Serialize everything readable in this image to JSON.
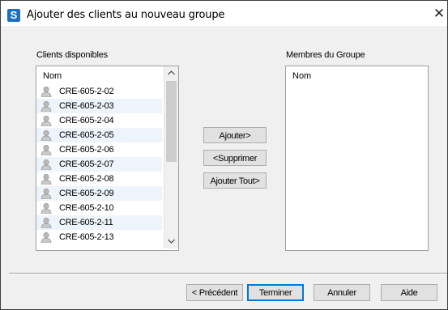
{
  "window": {
    "title": "Ajouter des clients au nouveau groupe",
    "close_glyph": "✕",
    "app_glyph": "S"
  },
  "available": {
    "label": "Clients disponibles",
    "header": "Nom",
    "items": [
      "CRE-605-2-02",
      "CRE-605-2-03",
      "CRE-605-2-04",
      "CRE-605-2-05",
      "CRE-605-2-06",
      "CRE-605-2-07",
      "CRE-605-2-08",
      "CRE-605-2-09",
      "CRE-605-2-10",
      "CRE-605-2-11",
      "CRE-605-2-13"
    ]
  },
  "members": {
    "label": "Membres du Groupe",
    "header": "Nom"
  },
  "actions": {
    "add": "Ajouter>",
    "remove": "<Supprimer",
    "add_all": "Ajouter Tout>"
  },
  "footer": {
    "previous": "< Précédent",
    "finish": "Terminer",
    "cancel": "Annuler",
    "help": "Aide"
  },
  "icons": {
    "app": "app-logo-icon",
    "close": "close-icon",
    "user": "user-icon",
    "scroll_up": "chevron-up-icon",
    "scroll_down": "chevron-down-icon"
  },
  "colors": {
    "accent": "#0078d7",
    "row_alt": "#eef4fb",
    "app_icon": "#1d6fc0"
  }
}
